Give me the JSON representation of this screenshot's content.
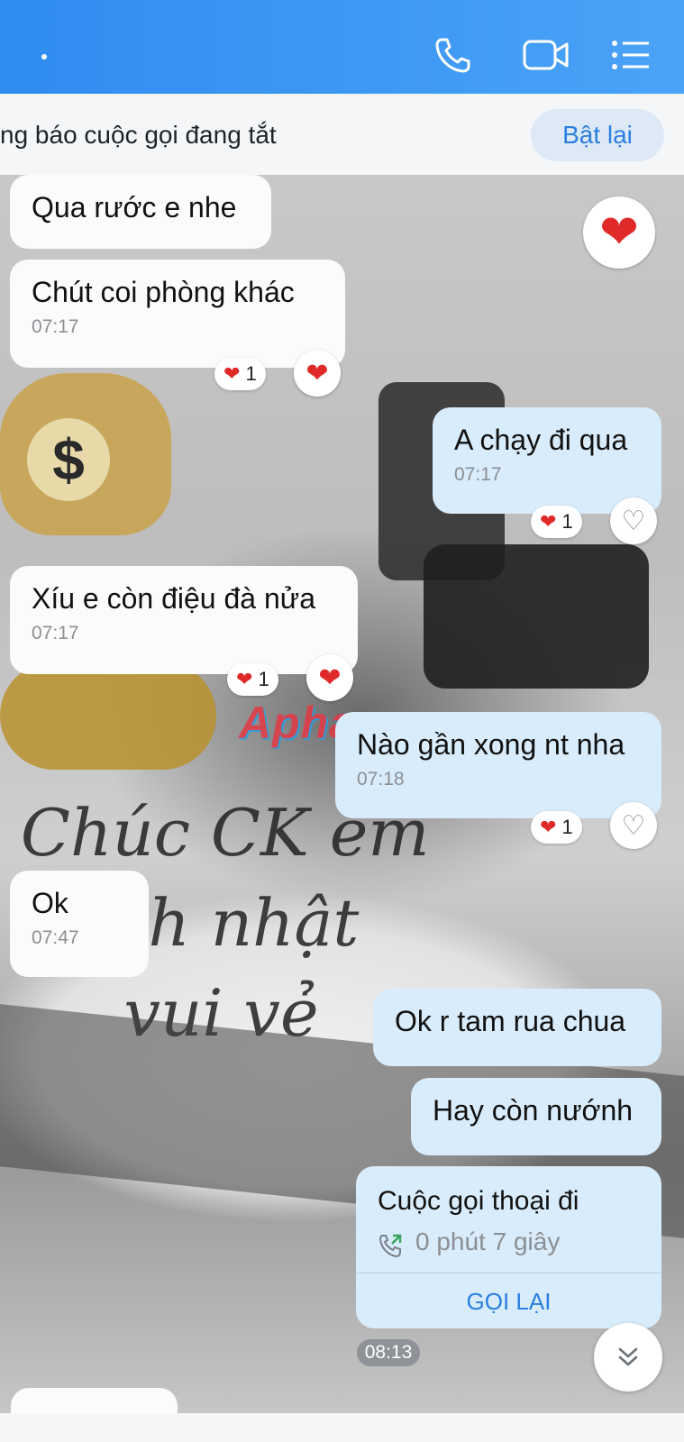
{
  "header": {
    "title": ".",
    "icons": [
      "phone-icon",
      "video-camera-icon",
      "list-menu-icon"
    ]
  },
  "notice": {
    "text": "ng báo cuộc gọi đang tắt",
    "button_label": "Bật lại"
  },
  "messages": [
    {
      "id": "m1",
      "side": "in",
      "text": "Qua rước e nhe"
    },
    {
      "id": "m2",
      "side": "in",
      "text": "Chút coi phòng khác",
      "time": "07:17",
      "reaction": {
        "emoji": "❤",
        "count": "1"
      }
    },
    {
      "id": "m3",
      "side": "out",
      "text": "A chạy đi qua",
      "time": "07:17",
      "reaction": {
        "emoji": "❤",
        "count": "1"
      }
    },
    {
      "id": "m4",
      "side": "in",
      "text": "Xíu e còn điệu đà nửa",
      "time": "07:17",
      "reaction": {
        "emoji": "❤",
        "count": "1"
      }
    },
    {
      "id": "m5",
      "side": "out",
      "text": "Nào gần xong nt nha",
      "time": "07:18",
      "reaction": {
        "emoji": "❤",
        "count": "1"
      }
    },
    {
      "id": "m6",
      "side": "in",
      "text": "Ok",
      "time": "07:47"
    },
    {
      "id": "m7",
      "side": "out",
      "text": "Ok r tam rua chua"
    },
    {
      "id": "m8",
      "side": "out",
      "text": "Hay còn nướnh"
    }
  ],
  "call_card": {
    "title": "Cuộc gọi thoại đi",
    "duration": "0 phút 7 giây",
    "action_label": "GỌI LẠI",
    "time": "08:13"
  },
  "watermark": "Aphang",
  "colors": {
    "header_blue": "#2f8cf0",
    "outgoing_bubble": "#d8ecfb",
    "incoming_bubble": "#fbfbfb",
    "heart": "#e02a2a",
    "link_blue": "#2a7fe0"
  }
}
